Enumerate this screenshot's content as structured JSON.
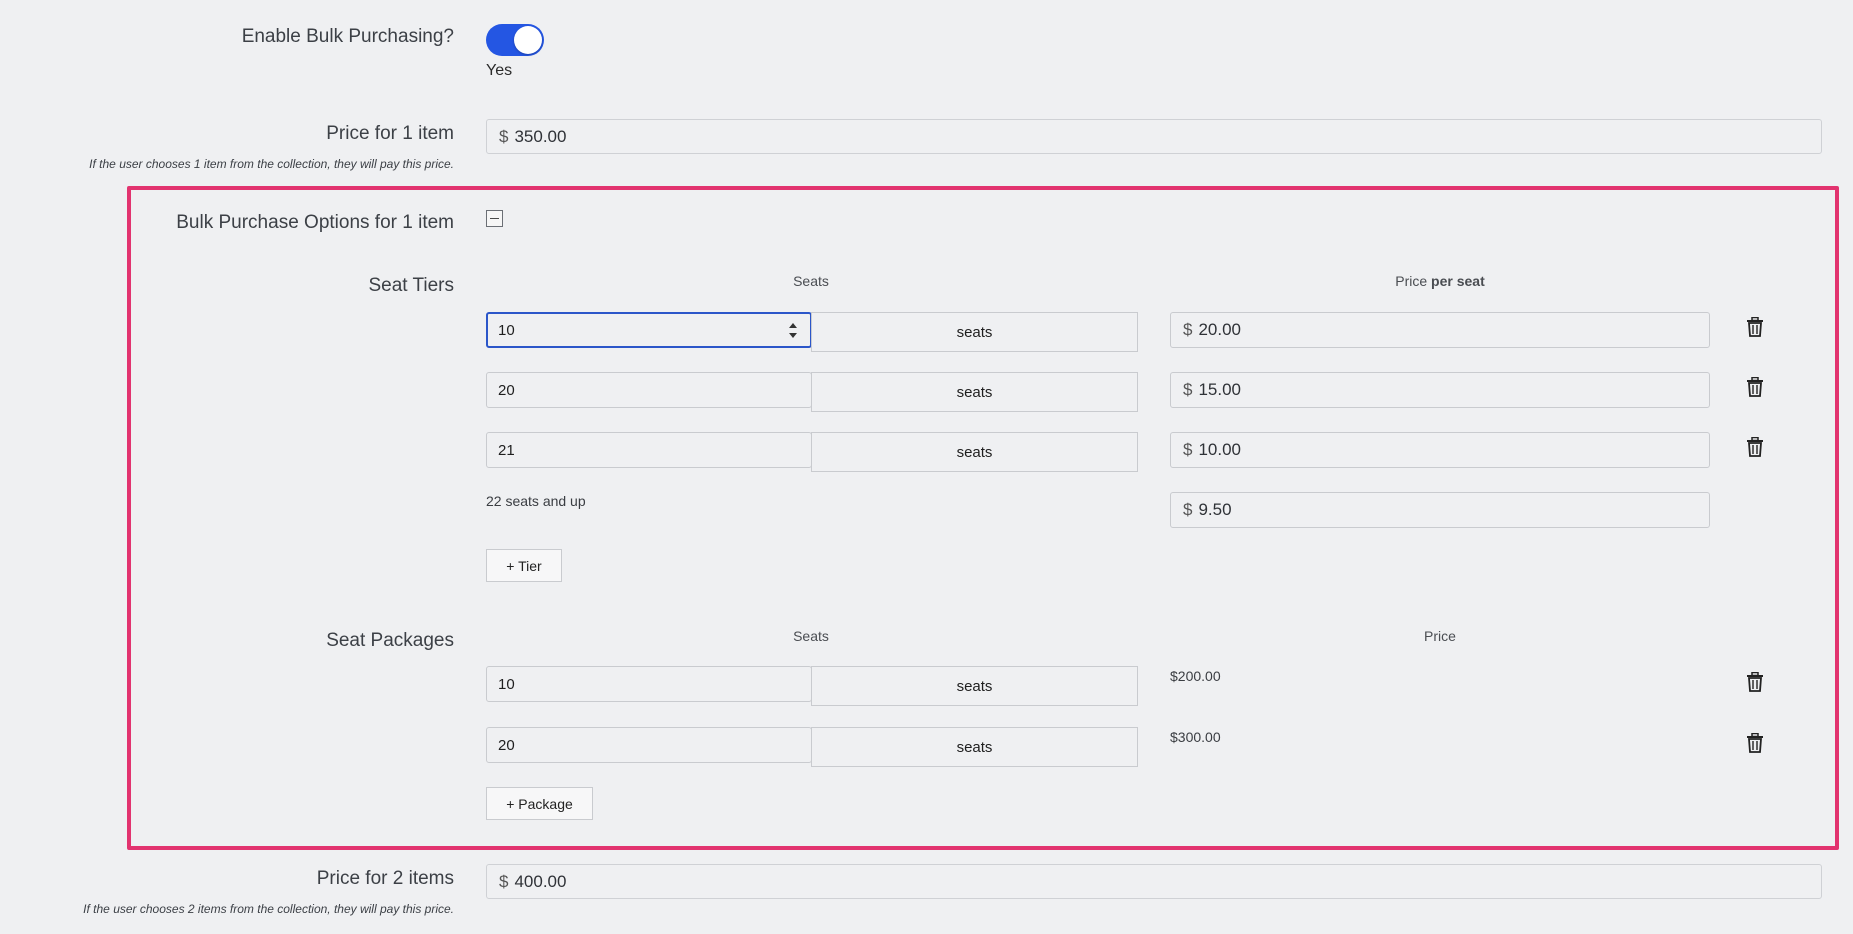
{
  "bulk": {
    "label": "Enable Bulk Purchasing?",
    "toggle_state": "Yes",
    "enabled": true
  },
  "price1": {
    "label": "Price for 1 item",
    "helper": "If the user chooses 1 item from the collection, they will pay this price.",
    "currency": "$",
    "value": "350.00"
  },
  "options": {
    "label": "Bulk Purchase Options for 1 item",
    "highlight_color": "#e2336f"
  },
  "tiers": {
    "label": "Seat Tiers",
    "seats_header": "Seats",
    "price_header_prefix": "Price",
    "price_header_bold": "per seat",
    "rows": [
      {
        "seats": "10",
        "unit": "seats",
        "currency": "$",
        "price": "20.00"
      },
      {
        "seats": "20",
        "unit": "seats",
        "currency": "$",
        "price": "15.00"
      },
      {
        "seats": "21",
        "unit": "seats",
        "currency": "$",
        "price": "10.00"
      }
    ],
    "last": {
      "label": "22 seats and up",
      "currency": "$",
      "price": "9.50"
    },
    "add_label": "+ Tier"
  },
  "packages": {
    "label": "Seat Packages",
    "seats_header": "Seats",
    "price_header": "Price",
    "rows": [
      {
        "seats": "10",
        "unit": "seats",
        "price": "$200.00"
      },
      {
        "seats": "20",
        "unit": "seats",
        "price": "$300.00"
      }
    ],
    "add_label": "+ Package"
  },
  "price2": {
    "label": "Price for 2 items",
    "helper": "If the user chooses 2 items from the collection, they will pay this price.",
    "currency": "$",
    "value": "400.00"
  }
}
